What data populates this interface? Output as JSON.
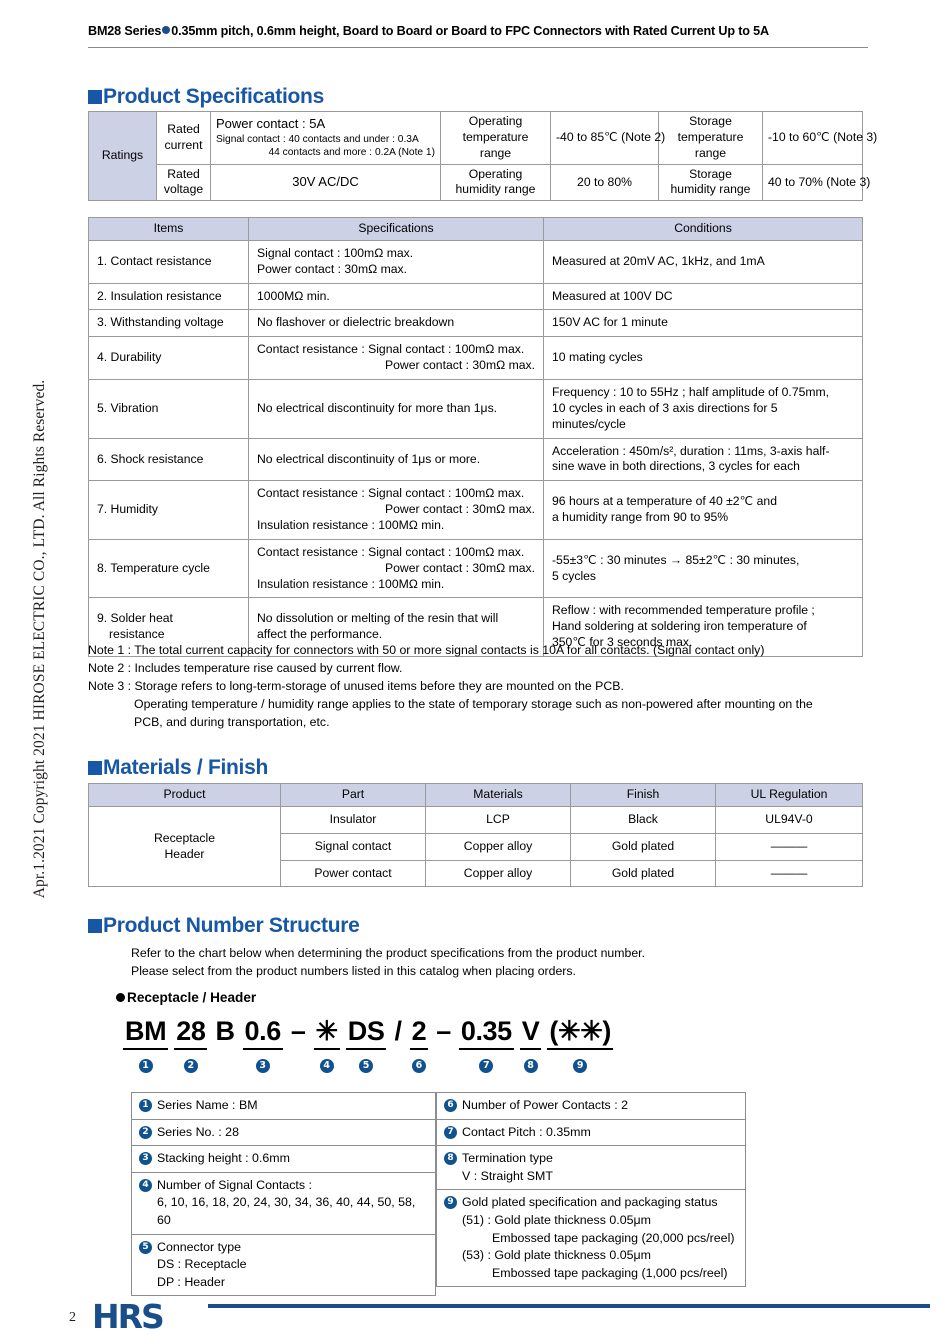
{
  "sidebar": {
    "copyright": "Apr.1.2021 Copyright 2021 HIROSE ELECTRIC CO., LTD. All Rights Reserved."
  },
  "header": {
    "title_before_bullet": "BM28 Series",
    "title_after_bullet": "0.35mm pitch, 0.6mm height, Board to Board or Board to FPC Connectors with Rated Current Up to 5A"
  },
  "sections": {
    "product_specifications": "Product Specifications",
    "materials_finish": "Materials / Finish",
    "product_number_structure": "Product Number Structure"
  },
  "ratings_table": {
    "row_label": "Ratings",
    "rows": [
      {
        "param": "Rated current",
        "param_line1": "Rated",
        "param_line2": "current",
        "value_main": "Power contact : 5A",
        "value_sub1": "Signal contact : 40 contacts and under : 0.3A",
        "value_sub2": "44 contacts and more  : 0.2A (Note 1)",
        "mid_label_line1": "Operating",
        "mid_label_line2": "temperature range",
        "mid_value": "-40 to 85℃ (Note 2)",
        "right_label_line1": "Storage",
        "right_label_line2": "temperature range",
        "right_value": "-10 to 60℃ (Note 3)"
      },
      {
        "param_line1": "Rated",
        "param_line2": "voltage",
        "value_main": "30V AC/DC",
        "mid_label_line1": "Operating",
        "mid_label_line2": "humidity range",
        "mid_value": "20 to 80%",
        "right_label_line1": "Storage",
        "right_label_line2": "humidity range",
        "right_value": "40 to 70% (Note 3)"
      }
    ]
  },
  "spec_table": {
    "headers": [
      "Items",
      "Specifications",
      "Conditions"
    ],
    "rows": [
      {
        "item": "1. Contact resistance",
        "spec_lines": [
          "Signal contact : 100mΩ max.",
          "Power contact : 30mΩ max."
        ],
        "spec_align": [
          "left",
          "left"
        ],
        "cond_lines": [
          "Measured at 20mV AC, 1kHz, and 1mA"
        ]
      },
      {
        "item": "2. Insulation resistance",
        "spec_lines": [
          "1000MΩ min."
        ],
        "spec_align": [
          "left"
        ],
        "cond_lines": [
          "Measured at 100V DC"
        ]
      },
      {
        "item": "3. Withstanding voltage",
        "spec_lines": [
          "No flashover or dielectric breakdown"
        ],
        "spec_align": [
          "left"
        ],
        "cond_lines": [
          "150V AC for 1 minute"
        ]
      },
      {
        "item": "4. Durability",
        "spec_lines": [
          "Contact resistance : Signal contact : 100mΩ max.",
          "Power contact : 30mΩ max."
        ],
        "spec_align": [
          "left",
          "right"
        ],
        "cond_lines": [
          "10 mating cycles"
        ]
      },
      {
        "item": "5. Vibration",
        "spec_lines": [
          "No electrical discontinuity for more than 1μs."
        ],
        "spec_align": [
          "left"
        ],
        "cond_lines": [
          "Frequency : 10 to 55Hz ; half amplitude of 0.75mm,",
          "10 cycles in each of 3 axis directions for 5 minutes/cycle"
        ]
      },
      {
        "item": "6. Shock resistance",
        "spec_lines": [
          "No electrical discontinuity of 1μs or more."
        ],
        "spec_align": [
          "left"
        ],
        "cond_lines": [
          "Acceleration : 450m/s², duration : 11ms, 3-axis half-",
          "sine wave in both directions, 3 cycles for each"
        ]
      },
      {
        "item": "7. Humidity",
        "spec_lines": [
          "Contact resistance : Signal contact : 100mΩ max.",
          "Power contact : 30mΩ max.",
          "Insulation resistance : 100MΩ min."
        ],
        "spec_align": [
          "left",
          "right",
          "left"
        ],
        "cond_lines": [
          "96 hours at a temperature of 40 ±2℃ and",
          "a humidity range from 90 to 95%"
        ]
      },
      {
        "item": "8. Temperature cycle",
        "spec_lines": [
          "Contact resistance : Signal contact : 100mΩ max.",
          "Power contact : 30mΩ max.",
          "Insulation resistance : 100MΩ min."
        ],
        "spec_align": [
          "left",
          "right",
          "left"
        ],
        "cond_lines": [
          "-55±3℃ : 30 minutes → 85±2℃ : 30 minutes,",
          "5 cycles"
        ]
      },
      {
        "item": "9. Solder heat resistance",
        "item_lines": [
          "9. Solder heat",
          "resistance"
        ],
        "spec_lines": [
          "No dissolution or melting of the resin that will",
          "affect the performance."
        ],
        "spec_align": [
          "left",
          "left"
        ],
        "cond_lines": [
          "Reflow : with recommended temperature profile ;",
          "Hand soldering at soldering iron temperature of",
          "350℃ for 3 seconds max."
        ]
      }
    ]
  },
  "notes": [
    "Note 1 : The total current capacity for connectors with 50 or more signal contacts is 10A for all contacts. (Signal contact only)",
    "Note 2 : Includes temperature rise caused by current flow.",
    "Note 3 : Storage refers to long-term-storage of unused items before they are mounted on the PCB."
  ],
  "notes_indented": [
    "Operating temperature / humidity range applies to the state of temporary storage such as non-powered after mounting on the",
    "PCB, and during transportation, etc."
  ],
  "materials_table": {
    "headers": [
      "Product",
      "Part",
      "Materials",
      "Finish",
      "UL Regulation"
    ],
    "product_lines": [
      "Receptacle",
      "Header"
    ],
    "rows": [
      {
        "part": "Insulator",
        "materials": "LCP",
        "finish": "Black",
        "ul": "UL94V-0"
      },
      {
        "part": "Signal contact",
        "materials": "Copper alloy",
        "finish": "Gold plated",
        "ul": "———"
      },
      {
        "part": "Power contact",
        "materials": "Copper alloy",
        "finish": "Gold plated",
        "ul": "———"
      }
    ]
  },
  "pns": {
    "intro_line1": "Refer to the chart below when determining the product specifications from the product number.",
    "intro_line2": "Please select from the product numbers listed in this catalog when placing orders.",
    "subheading": "Receptacle / Header",
    "segments": [
      {
        "text": "BM",
        "marker": "❶",
        "underlined": true
      },
      {
        "text": "28",
        "marker": "❷",
        "underlined": true
      },
      {
        "text": "B",
        "marker": "",
        "underlined": false
      },
      {
        "text": "0.6",
        "marker": "❸",
        "underlined": true
      },
      {
        "text": "–",
        "marker": "",
        "underlined": false
      },
      {
        "text": "✳",
        "marker": "❹",
        "underlined": true
      },
      {
        "text": "DS",
        "marker": "❺",
        "underlined": true
      },
      {
        "text": "/",
        "marker": "",
        "underlined": false
      },
      {
        "text": "2",
        "marker": "❻",
        "underlined": true
      },
      {
        "text": "–",
        "marker": "",
        "underlined": false
      },
      {
        "text": "0.35",
        "marker": "❼",
        "underlined": true
      },
      {
        "text": "V",
        "marker": "❽",
        "underlined": true
      },
      {
        "text": "(✳✳)",
        "marker": "❾",
        "underlined": true
      }
    ]
  },
  "legend": {
    "left": [
      {
        "marker": "❶",
        "lines": [
          "Series Name : BM"
        ]
      },
      {
        "marker": "❷",
        "lines": [
          "Series No. : 28"
        ]
      },
      {
        "marker": "❸",
        "lines": [
          "Stacking height : 0.6mm"
        ]
      },
      {
        "marker": "❹",
        "lines": [
          "Number of Signal Contacts :",
          "6, 10, 16, 18, 20, 24, 30, 34, 36, 40, 44, 50, 58, 60"
        ],
        "indents": [
          0,
          1
        ]
      },
      {
        "marker": "❺",
        "lines": [
          "Connector type",
          "DS : Receptacle",
          "DP : Header"
        ],
        "indents": [
          0,
          1,
          1
        ]
      }
    ],
    "right": [
      {
        "marker": "❻",
        "lines": [
          "Number of Power Contacts : 2"
        ]
      },
      {
        "marker": "❼",
        "lines": [
          "Contact Pitch : 0.35mm"
        ]
      },
      {
        "marker": "❽",
        "lines": [
          "Termination type",
          "V : Straight SMT"
        ],
        "indents": [
          0,
          1
        ]
      },
      {
        "marker": "❾",
        "lines": [
          "Gold plated specification and packaging status",
          "(51) : Gold plate thickness 0.05μm",
          "Embossed tape packaging (20,000 pcs/reel)",
          "(53) : Gold plate thickness 0.05μm",
          "Embossed tape packaging (1,000 pcs/reel)"
        ],
        "indents": [
          0,
          1,
          3,
          1,
          3
        ]
      }
    ]
  },
  "footer": {
    "page_number": "2",
    "logo": "HRS"
  },
  "colors": {
    "accent_blue": "#1757a6",
    "logo_blue": "#1a4e8a",
    "table_header_fill": "#ccd1e6",
    "marker_circle": "#10528f"
  }
}
